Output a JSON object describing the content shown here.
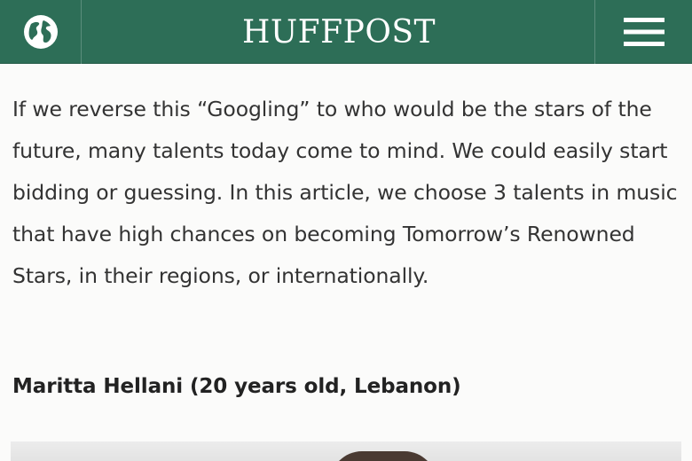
{
  "header": {
    "logo_text": "HUFFPOST",
    "globe_icon": "globe-icon",
    "menu_icon": "hamburger-menu-icon",
    "bar_color": "#2d6e57"
  },
  "article": {
    "paragraph": "If we reverse this “Googling” to who would be the stars of the future, many talents today come to mind. We could easily start bidding or guessing. In this article, we choose 3 talents in music that have high chances on becoming Tomorrow’s Renowned Stars, in their regions, or internationally.",
    "subheading": "Maritta Hellani (20 years old, Lebanon)"
  },
  "image": {
    "description_icon": "article-photo"
  }
}
